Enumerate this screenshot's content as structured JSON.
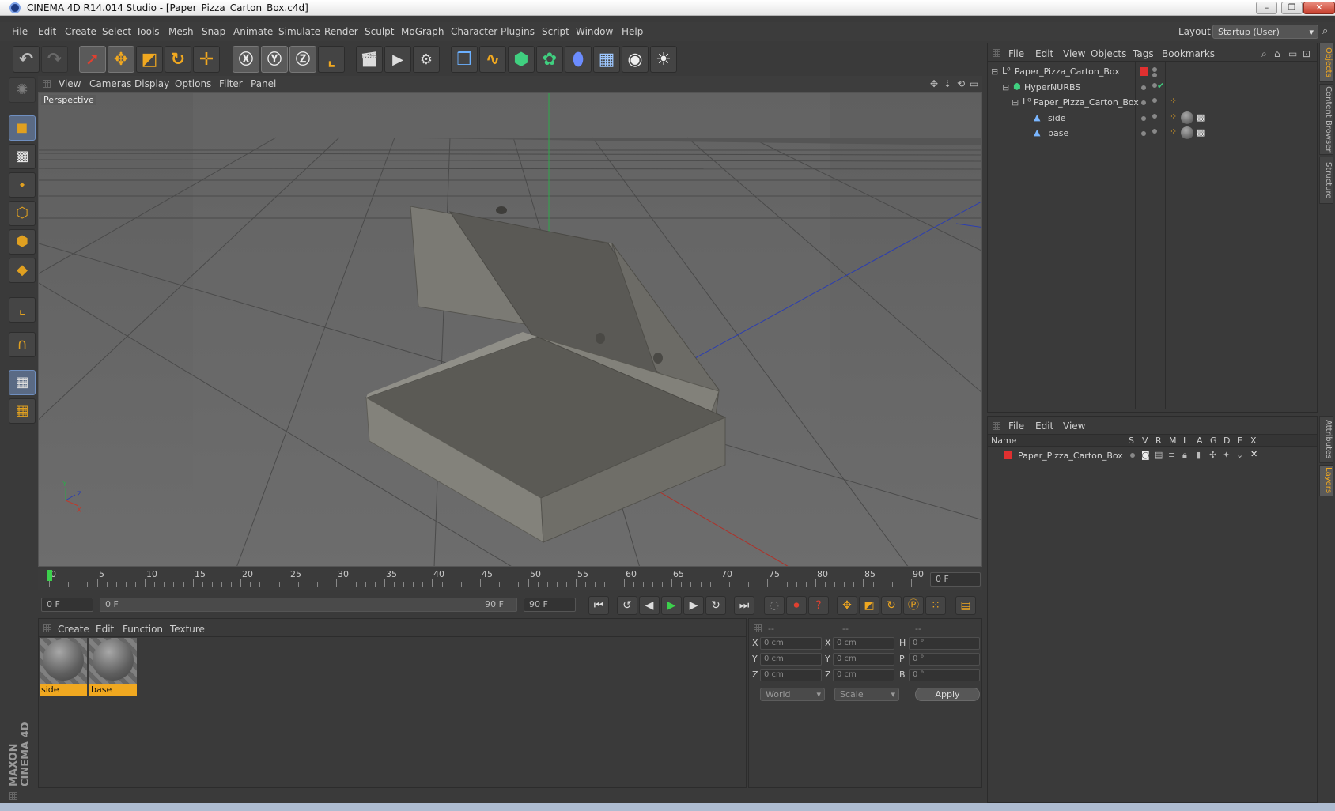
{
  "window": {
    "title": "CINEMA 4D R14.014 Studio - [Paper_Pizza_Carton_Box.c4d]",
    "min": "–",
    "max": "❐",
    "close": "✕"
  },
  "menu": [
    "File",
    "Edit",
    "Create",
    "Select",
    "Tools",
    "Mesh",
    "Snap",
    "Animate",
    "Simulate",
    "Render",
    "Sculpt",
    "MoGraph",
    "Character",
    "Plugins",
    "Script",
    "Window",
    "Help"
  ],
  "layout": {
    "label": "Layout:",
    "value": "Startup (User)"
  },
  "viewport": {
    "menu": [
      "View",
      "Cameras",
      "Display",
      "Options",
      "Filter",
      "Panel"
    ],
    "label": "Perspective",
    "axes": {
      "x": "X",
      "y": "Y",
      "z": "Z"
    }
  },
  "timeline": {
    "ticks": [
      "0",
      "5",
      "10",
      "15",
      "20",
      "25",
      "30",
      "35",
      "40",
      "45",
      "50",
      "55",
      "60",
      "65",
      "70",
      "75",
      "80",
      "85",
      "90"
    ],
    "current": "0 F",
    "start": "0 F",
    "range_start": "0 F",
    "range_end": "90 F",
    "end": "90 F",
    "playhead_frame": 0
  },
  "materials": {
    "menu": [
      "Create",
      "Edit",
      "Function",
      "Texture"
    ],
    "items": [
      {
        "name": "side"
      },
      {
        "name": "base"
      }
    ]
  },
  "coords": {
    "headers": [
      "--",
      "--",
      "--"
    ],
    "rows": [
      {
        "l1": "X",
        "v1": "0 cm",
        "l2": "X",
        "v2": "0 cm",
        "l3": "H",
        "v3": "0 °"
      },
      {
        "l1": "Y",
        "v1": "0 cm",
        "l2": "Y",
        "v2": "0 cm",
        "l3": "P",
        "v3": "0 °"
      },
      {
        "l1": "Z",
        "v1": "0 cm",
        "l2": "Z",
        "v2": "0 cm",
        "l3": "B",
        "v3": "0 °"
      }
    ],
    "mode": "World",
    "scale": "Scale",
    "apply": "Apply"
  },
  "objects": {
    "menu": [
      "File",
      "Edit",
      "View",
      "Objects",
      "Tags",
      "Bookmarks"
    ],
    "tree": [
      {
        "name": "Paper_Pizza_Carton_Box"
      },
      {
        "name": "HyperNURBS"
      },
      {
        "name": "Paper_Pizza_Carton_Box"
      },
      {
        "name": "side"
      },
      {
        "name": "base"
      }
    ]
  },
  "layers": {
    "menu": [
      "File",
      "Edit",
      "View"
    ],
    "columns": [
      "Name",
      "S",
      "V",
      "R",
      "M",
      "L",
      "A",
      "G",
      "D",
      "E",
      "X"
    ],
    "items": [
      {
        "name": "Paper_Pizza_Carton_Box",
        "color": "#e03030"
      }
    ]
  },
  "side_tabs": [
    "Objects",
    "Content Browser",
    "Structure",
    "Attributes",
    "Layers"
  ],
  "brand": "MAXON CINEMA 4D",
  "colors": {
    "accent": "#f0a820",
    "x_axis": "#c0392b",
    "y_axis": "#27ae60",
    "z_axis": "#2c3eb0",
    "layer": "#e03030"
  }
}
